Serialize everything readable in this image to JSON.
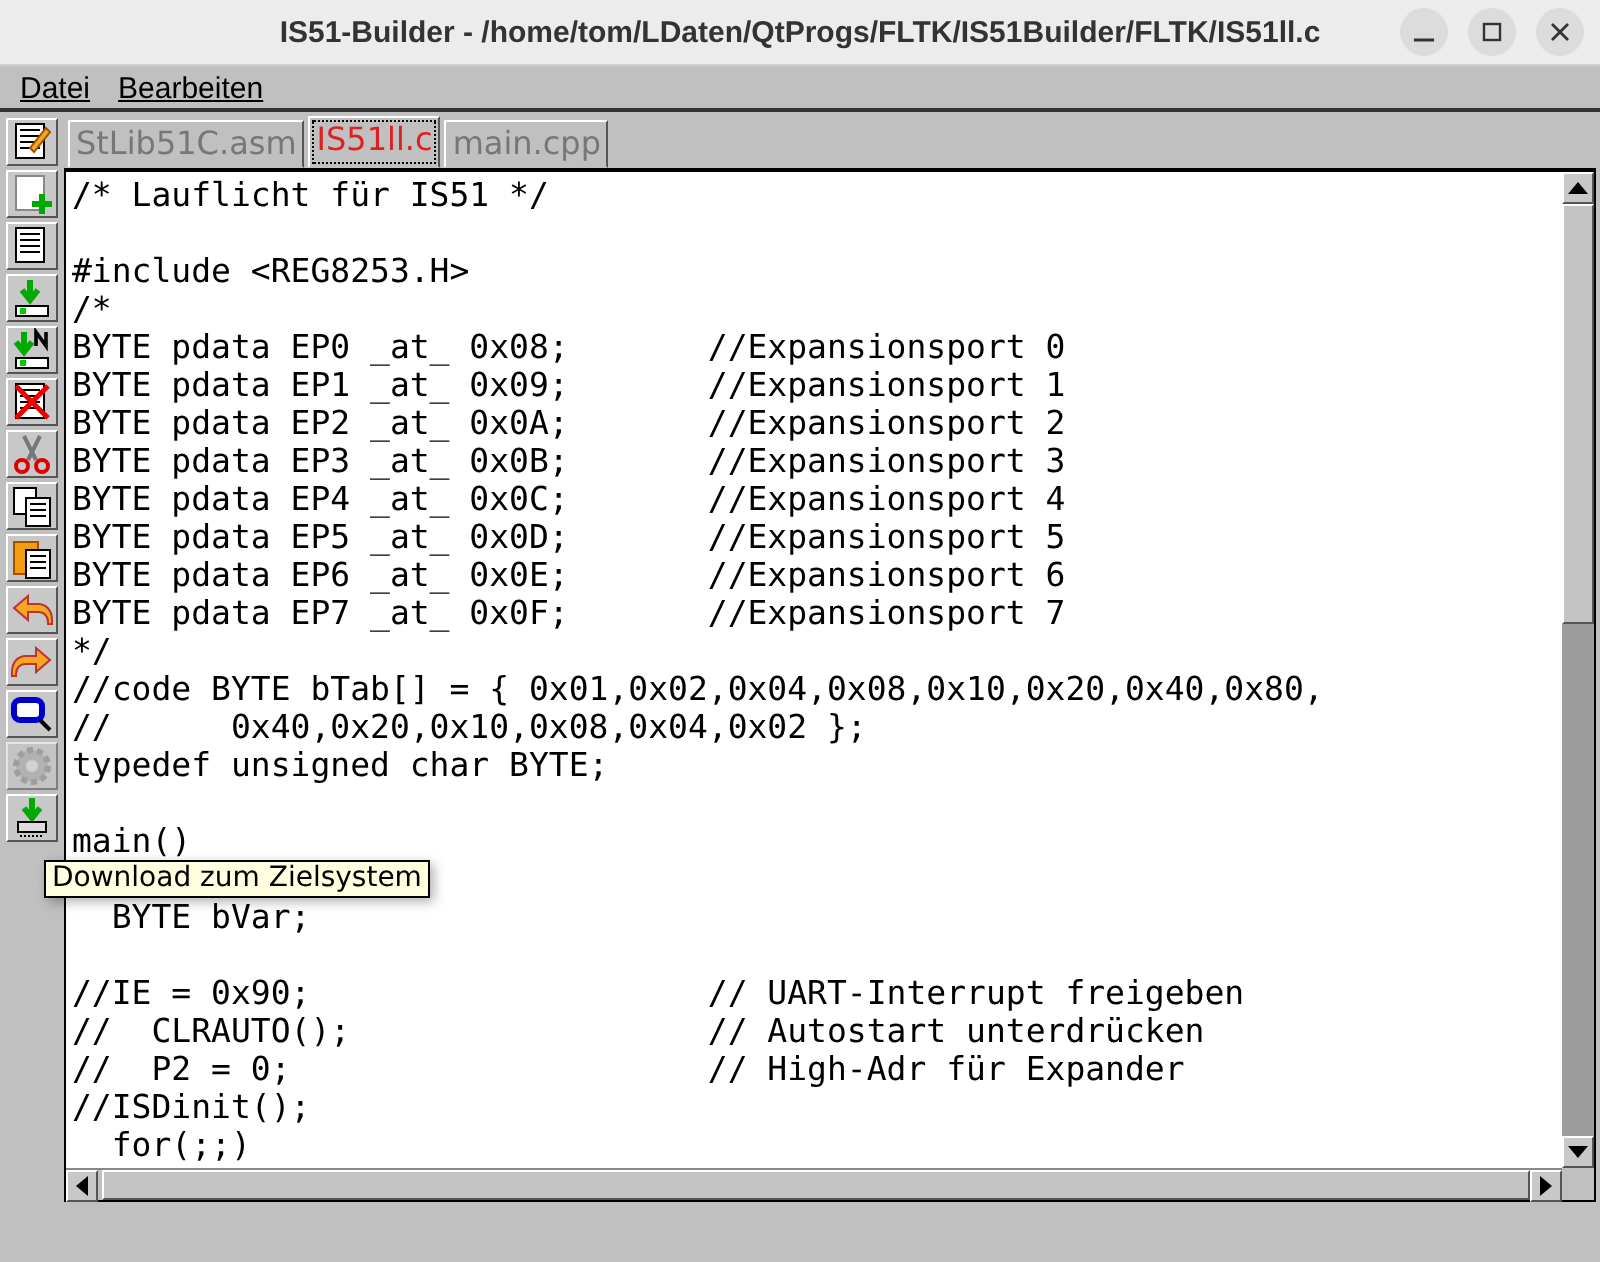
{
  "window": {
    "title": "IS51-Builder - /home/tom/LDaten/QtProgs/FLTK/IS51Builder/FLTK/IS51ll.c"
  },
  "menu": [
    "Datei",
    "Bearbeiten"
  ],
  "toolbar": [
    {
      "kind": "edit"
    },
    {
      "kind": "new"
    },
    {
      "kind": "doc"
    },
    {
      "kind": "load"
    },
    {
      "kind": "loadn"
    },
    {
      "kind": "delete"
    },
    {
      "kind": "cut"
    },
    {
      "kind": "copy"
    },
    {
      "kind": "paste"
    },
    {
      "kind": "undo"
    },
    {
      "kind": "redo"
    },
    {
      "kind": "find"
    },
    {
      "kind": "gear",
      "disabled": true
    },
    {
      "kind": "download"
    }
  ],
  "tabs": [
    {
      "label": "StLib51C.asm",
      "selected": false
    },
    {
      "label": "IS51ll.c",
      "selected": true
    },
    {
      "label": "main.cpp",
      "selected": false
    }
  ],
  "code_blocks": [
    [
      "/* Lauflicht für IS51 */"
    ],
    [
      "#include <REG8253.H>",
      "/*",
      "BYTE pdata EP0 _at_ 0x08;       //Expansionsport 0",
      "BYTE pdata EP1 _at_ 0x09;       //Expansionsport 1",
      "BYTE pdata EP2 _at_ 0x0A;       //Expansionsport 2",
      "BYTE pdata EP3 _at_ 0x0B;       //Expansionsport 3",
      "BYTE pdata EP4 _at_ 0x0C;       //Expansionsport 4",
      "BYTE pdata EP5 _at_ 0x0D;       //Expansionsport 5",
      "BYTE pdata EP6 _at_ 0x0E;       //Expansionsport 6",
      "BYTE pdata EP7 _at_ 0x0F;       //Expansionsport 7",
      "*/",
      "//code BYTE bTab[] = { 0x01,0x02,0x04,0x08,0x10,0x20,0x40,0x80,",
      "//      0x40,0x20,0x10,0x08,0x04,0x02 };",
      "typedef unsigned char BYTE;"
    ],
    [
      "main()"
    ],
    [
      "  BYTE bVar;"
    ],
    [
      "//IE = 0x90;                    // UART-Interrupt freigeben",
      "//  CLRAUTO();                  // Autostart unterdrücken",
      "//  P2 = 0;                     // High-Adr für Expander",
      "//ISDinit();",
      "  for(;;)"
    ]
  ],
  "tooltip": "Download zum Zielsystem"
}
